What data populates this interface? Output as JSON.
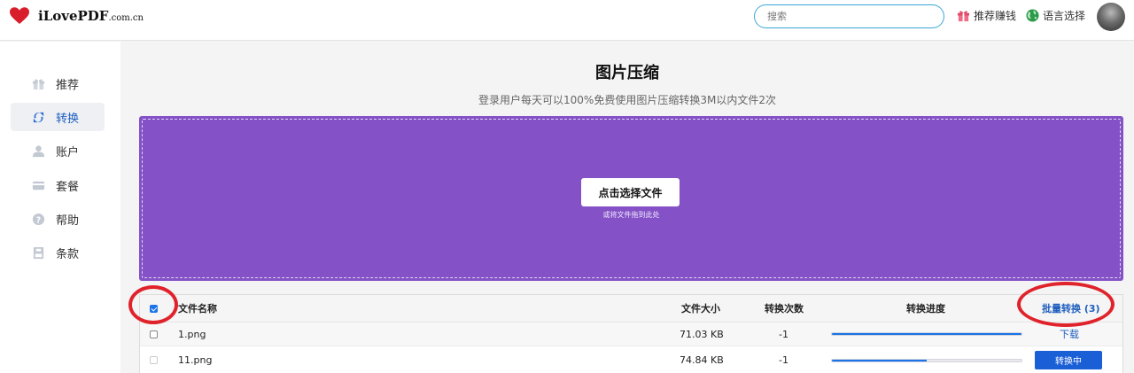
{
  "header": {
    "brand": "iLovePDF",
    "brand_suffix": ".com.cn",
    "search_placeholder": "搜索",
    "referral_label": "推荐赚钱",
    "language_label": "语言选择",
    "colors": {
      "heart": "#d81e2a",
      "search_border": "#3aa6d8"
    }
  },
  "sidebar": {
    "items": [
      {
        "label": "推荐",
        "icon": "gift-icon",
        "active": false
      },
      {
        "label": "转换",
        "icon": "convert-arrows-icon",
        "active": true
      },
      {
        "label": "账户",
        "icon": "user-icon",
        "active": false
      },
      {
        "label": "套餐",
        "icon": "credit-card-icon",
        "active": false
      },
      {
        "label": "帮助",
        "icon": "help-circle-icon",
        "active": false
      },
      {
        "label": "条款",
        "icon": "document-icon",
        "active": false
      }
    ]
  },
  "main": {
    "title": "图片压缩",
    "subtitle": "登录用户每天可以100%免费使用图片压缩转换3M以内文件2次",
    "dropzone": {
      "button_label": "点击选择文件",
      "hint": "或将文件拖到此处",
      "color": "#8452c6"
    }
  },
  "table": {
    "columns": {
      "name": "文件名称",
      "size": "文件大小",
      "count": "转换次数",
      "progress": "转换进度",
      "batch_action": "批量转换 (3)"
    },
    "select_all_checked": true,
    "rows": [
      {
        "name": "1.png",
        "size": "71.03 KB",
        "count": "-1",
        "progress": 1.0,
        "action": "下载",
        "action_type": "link",
        "checkbox_enabled": true
      },
      {
        "name": "11.png",
        "size": "74.84 KB",
        "count": "-1",
        "progress": 0.5,
        "action": "转换中",
        "action_type": "button",
        "checkbox_enabled": false
      }
    ]
  }
}
